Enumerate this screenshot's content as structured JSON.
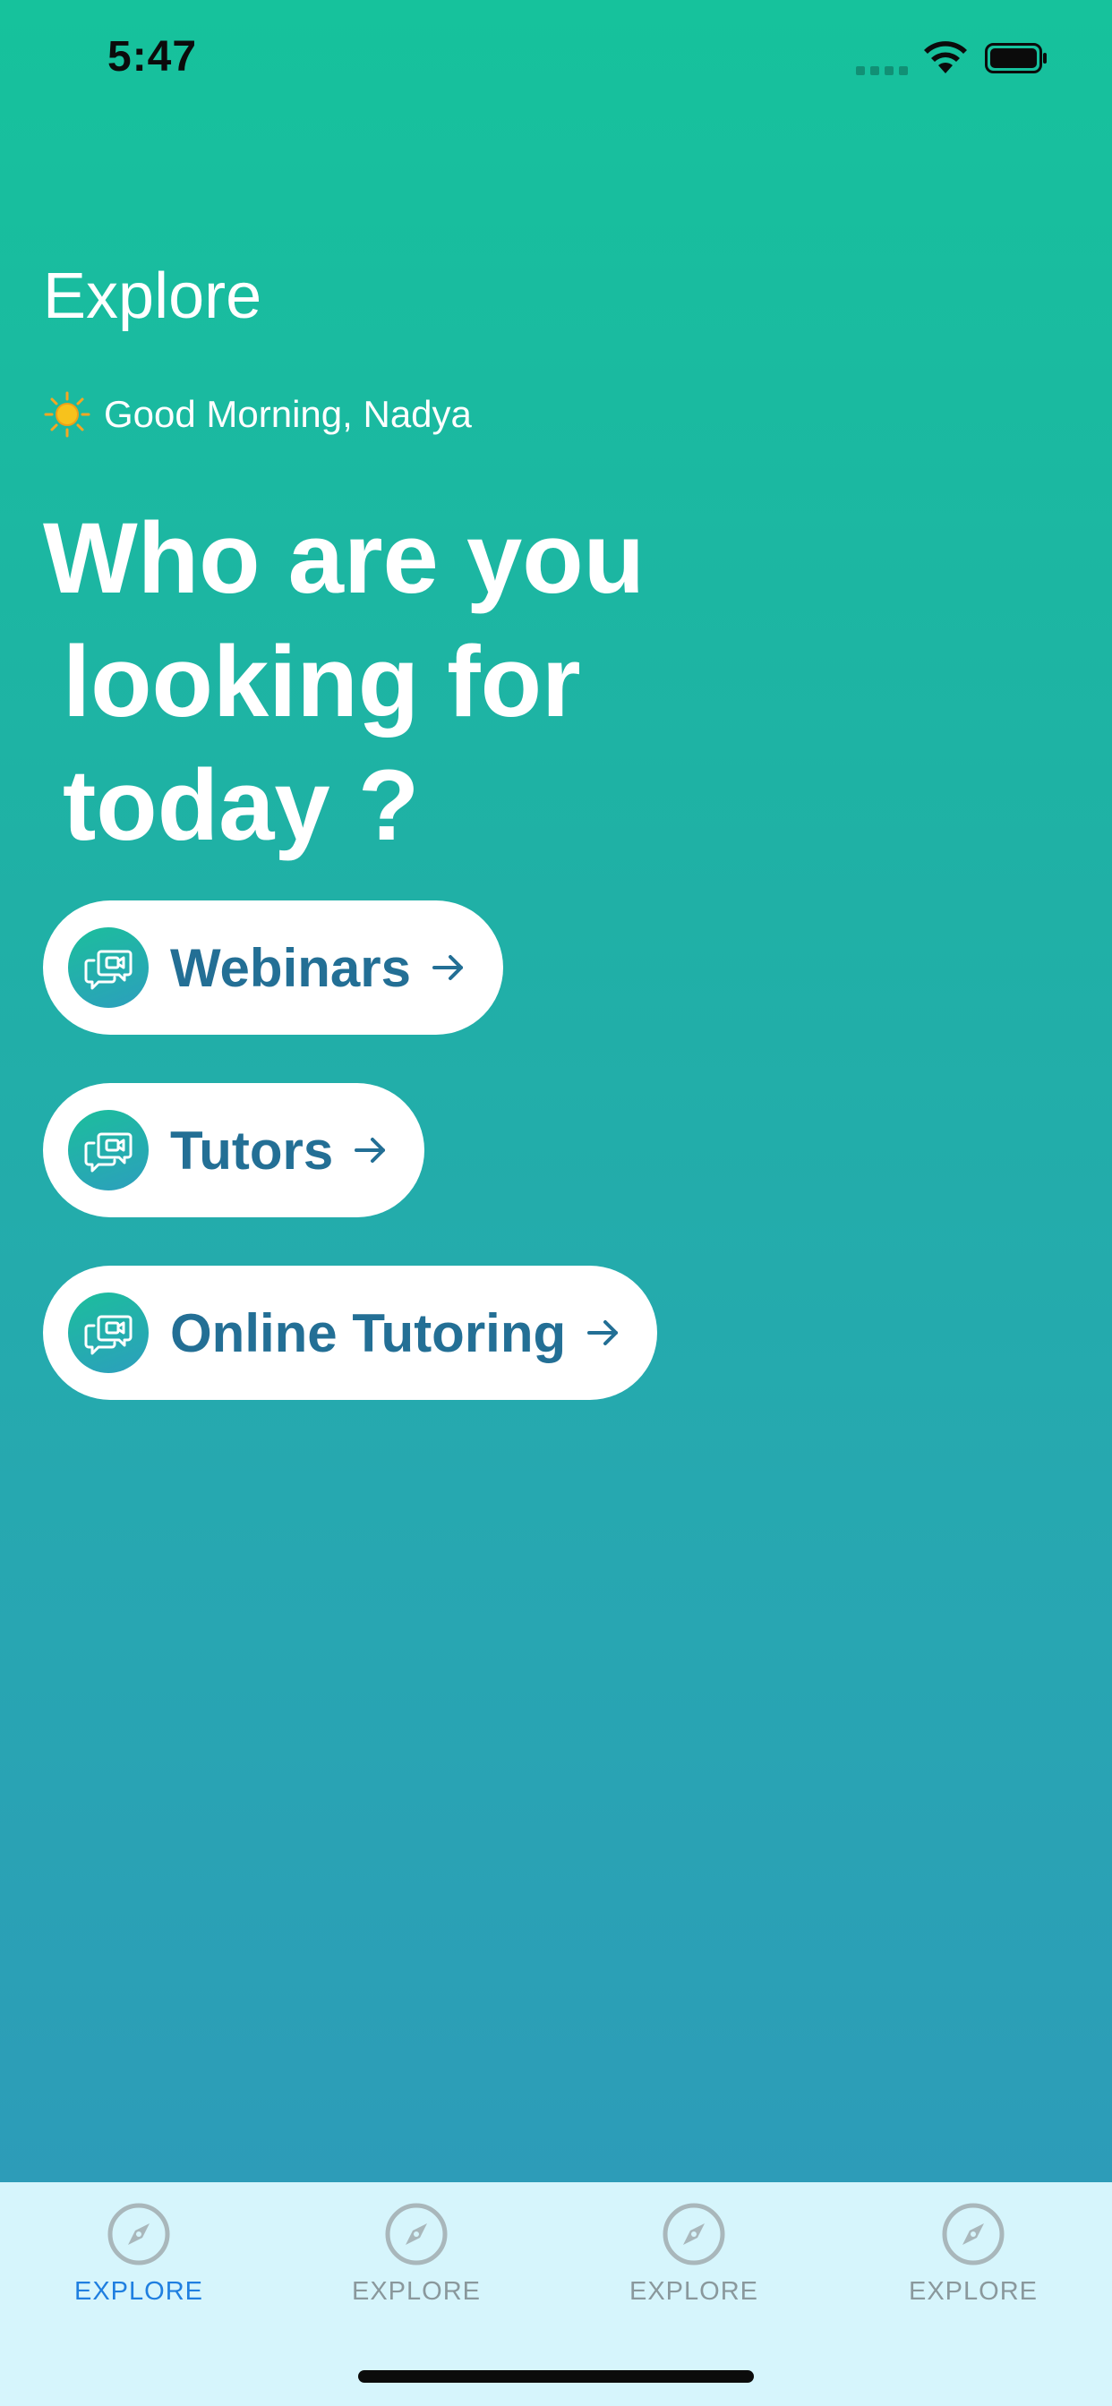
{
  "status_bar": {
    "time": "5:47"
  },
  "header": {
    "title": "Explore",
    "greeting_icon": "sun-icon",
    "greeting": "Good Morning, Nadya"
  },
  "headline": {
    "line1": "Who are you",
    "line2": "looking for",
    "line3": "today ?"
  },
  "categories": [
    {
      "label": "Webinars",
      "icon": "video-chat-icon"
    },
    {
      "label": "Tutors",
      "icon": "video-chat-icon"
    },
    {
      "label": "Online Tutoring",
      "icon": "video-chat-icon"
    }
  ],
  "tab_bar": {
    "active_index": 0,
    "tabs": [
      {
        "label": "EXPLORE",
        "icon": "compass-icon"
      },
      {
        "label": "EXPLORE",
        "icon": "compass-icon"
      },
      {
        "label": "EXPLORE",
        "icon": "compass-icon"
      },
      {
        "label": "EXPLORE",
        "icon": "compass-icon"
      }
    ]
  },
  "colors": {
    "gradient_top": "#16c29c",
    "gradient_bottom": "#2f98bb",
    "pill_text": "#236f95",
    "tab_bar_bg": "#d6f5fc",
    "tab_active": "#1f7fe0",
    "tab_inactive": "#8a989c"
  }
}
